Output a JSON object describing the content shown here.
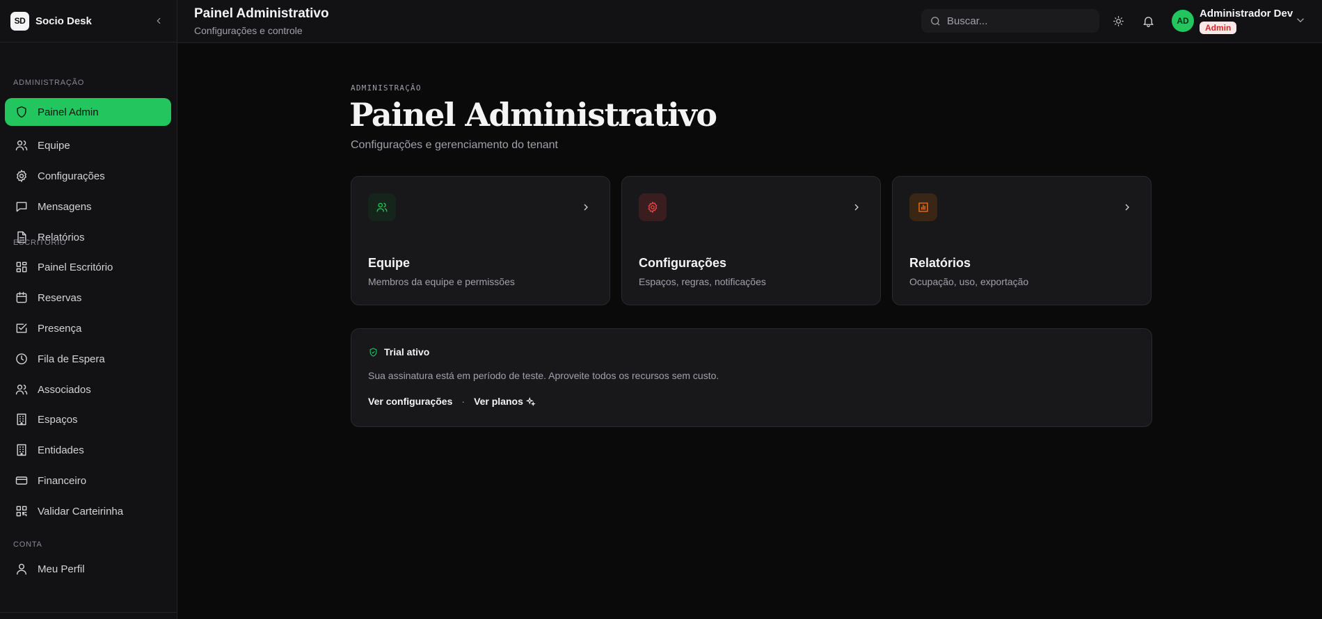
{
  "app": {
    "logo": "SD",
    "name": "Socio Desk"
  },
  "sidebar": {
    "sections": [
      {
        "label": "ADMINISTRAÇÃO"
      },
      {
        "label": "ESCRITÓRIO"
      },
      {
        "label": "CONTA"
      }
    ],
    "items": [
      {
        "label": "Painel Admin",
        "icon": "shield-icon",
        "active": true
      },
      {
        "label": "Equipe",
        "icon": "users-icon"
      },
      {
        "label": "Configurações",
        "icon": "gear-icon"
      },
      {
        "label": "Mensagens",
        "icon": "message-icon"
      },
      {
        "label": "Relatórios",
        "icon": "file-text-icon"
      },
      {
        "label": "Painel Escritório",
        "icon": "dashboard-icon"
      },
      {
        "label": "Reservas",
        "icon": "calendar-icon"
      },
      {
        "label": "Presença",
        "icon": "check-square-icon"
      },
      {
        "label": "Fila de Espera",
        "icon": "clock-icon"
      },
      {
        "label": "Associados",
        "icon": "users-icon"
      },
      {
        "label": "Espaços",
        "icon": "building-icon"
      },
      {
        "label": "Entidades",
        "icon": "building-icon"
      },
      {
        "label": "Financeiro",
        "icon": "credit-card-icon"
      },
      {
        "label": "Validar Carteirinha",
        "icon": "qr-code-icon"
      },
      {
        "label": "Meu Perfil",
        "icon": "user-icon"
      }
    ]
  },
  "header": {
    "title": "Painel Administrativo",
    "subtitle": "Configurações e controle",
    "search_placeholder": "Buscar...",
    "user": {
      "initials": "AD",
      "name": "Administrador Dev",
      "role": "Admin"
    }
  },
  "main": {
    "eyebrow": "ADMINISTRAÇÃO",
    "title": "Painel Administrativo",
    "subtitle": "Configurações e gerenciamento do tenant",
    "cards": [
      {
        "title": "Equipe",
        "description": "Membros da equipe e permissões",
        "icon": "users-icon",
        "accent": "#22c55e"
      },
      {
        "title": "Configurações",
        "description": "Espaços, regras, notificações",
        "icon": "gear-icon",
        "accent": "#ef4444"
      },
      {
        "title": "Relatórios",
        "description": "Ocupação, uso, exportação",
        "icon": "bar-chart-icon",
        "accent": "#f97316"
      }
    ],
    "trial": {
      "title": "Trial ativo",
      "text": "Sua assinatura está em período de teste. Aproveite todos os recursos sem custo.",
      "link_settings": "Ver configurações",
      "separator": "·",
      "link_plans": "Ver planos"
    }
  },
  "colors": {
    "accent": "#22c55e",
    "background": "#0a0a0a",
    "surface": "#18181b",
    "badge_text": "#dc2626"
  }
}
